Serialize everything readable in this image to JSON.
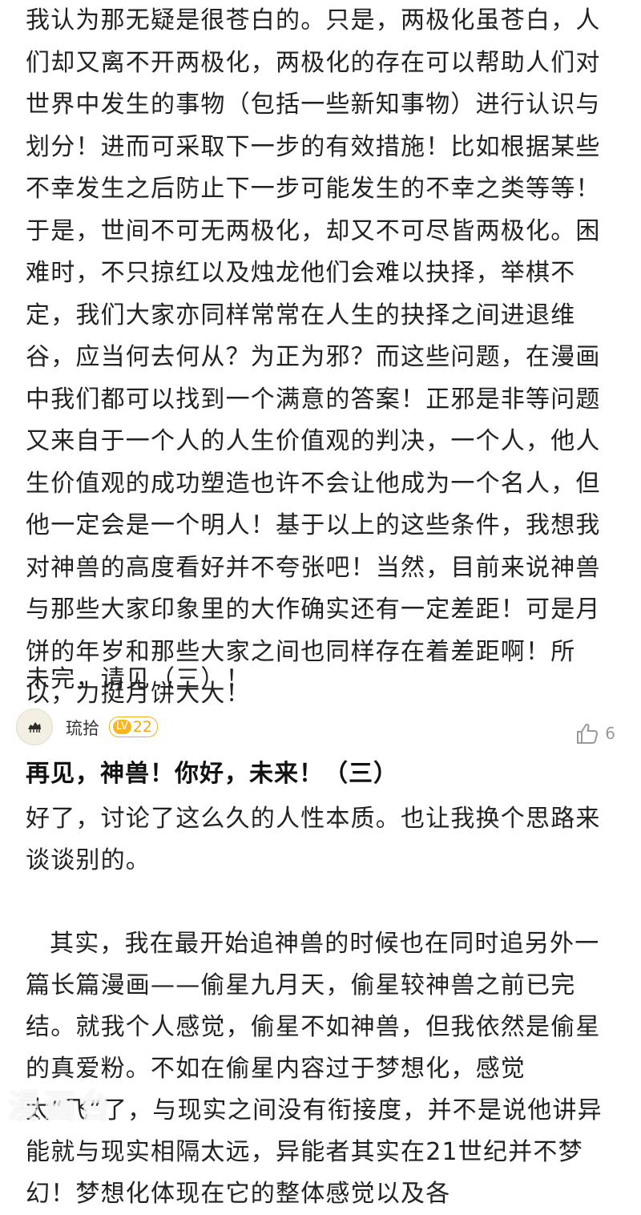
{
  "previous_post": {
    "paragraph": "我认为那无疑是很苍白的。只是，两极化虽苍白，人们却又离不开两极化，两极化的存在可以帮助人们对世界中发生的事物（包括一些新知事物）进行认识与划分！进而可采取下一步的有效措施！比如根据某些不幸发生之后防止下一步可能发生的不幸之类等等！于是，世间不可无两极化，却又不可尽皆两极化。困难时，不只掠红以及烛龙他们会难以抉择，举棋不定，我们大家亦同样常常在人生的抉择之间进退维谷，应当何去何从？为正为邪？而这些问题，在漫画中我们都可以找到一个满意的答案！正邪是非等问题又来自于一个人的人生价值观的判决，一个人，他人生价值观的成功塑造也许不会让他成为一个名人，但他一定会是一个明人！基于以上的这些条件，我想我对神兽的高度看好并不夸张吧！当然，目前来说神兽与那些大家印象里的大作确实还有一定差距！可是月饼的年岁和那些大家之间也同样存在着差距啊！所以，力挺月饼大大！",
    "ending_note": "未完，请见（三）！"
  },
  "post": {
    "username": "琉拾",
    "level_prefix": "LV",
    "level_number": "22",
    "like_count": "6",
    "title": "再见，神兽！你好，未来！（三）",
    "paragraphs": [
      "好了，讨论了这么久的人性本质。也让我换个思路来谈谈别的。",
      "其实，我在最开始追神兽的时候也在同时追另外一篇长篇漫画——偷星九月天，偷星较神兽之前已完结。就我个人感觉，偷星不如神兽，但我依然是偷星的真爱粉。不如在偷星内容过于梦想化，感觉太“飞”了，与现实之间没有衔接度，并不是说他讲异能就与现实相隔太远，异能者其实在21世纪并不梦幻！梦想化体现在它的整体感觉以及各"
    ]
  },
  "watermark": {
    "text": "漫画台"
  },
  "icons": {
    "avatar": "avatar-icon",
    "like": "thumbs-up-icon"
  },
  "colors": {
    "level_badge": "#f2b21d",
    "text": "#222222",
    "muted": "#999999"
  }
}
